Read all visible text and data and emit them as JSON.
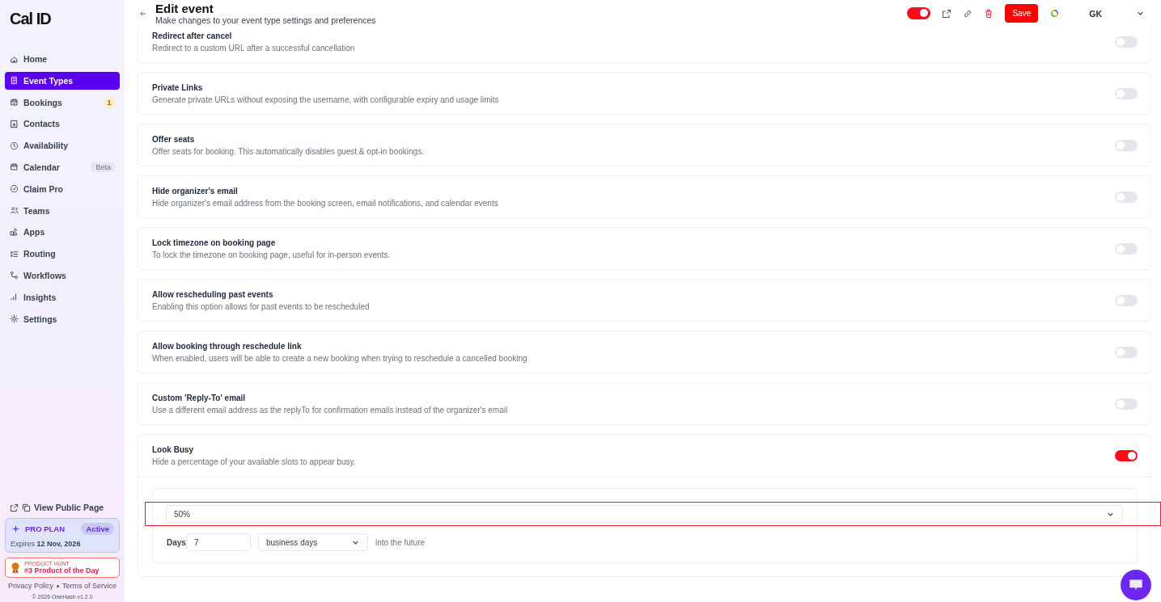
{
  "sidebar": {
    "logo": "Cal ID",
    "items": [
      {
        "label": "Home",
        "selected": false
      },
      {
        "label": "Event Types",
        "selected": true
      },
      {
        "label": "Bookings",
        "selected": false,
        "badge": {
          "text": "1",
          "kind": "count"
        }
      },
      {
        "label": "Contacts",
        "selected": false
      },
      {
        "label": "Availability",
        "selected": false
      },
      {
        "label": "Calendar",
        "selected": false,
        "badge": {
          "text": "Beta",
          "kind": "tag"
        }
      },
      {
        "label": "Claim Pro",
        "selected": false
      },
      {
        "label": "Teams",
        "selected": false
      },
      {
        "label": "Apps",
        "selected": false
      },
      {
        "label": "Routing",
        "selected": false
      },
      {
        "label": "Workflows",
        "selected": false
      },
      {
        "label": "Insights",
        "selected": false
      },
      {
        "label": "Settings",
        "selected": false
      }
    ],
    "public_page": "View Public Page",
    "plan": {
      "name": "PRO PLAN",
      "status": "Active",
      "expires_label": "Expires",
      "expires_date": "12 Nov, 2026"
    },
    "product_hunt": {
      "eyebrow": "PRODUCT HUNT",
      "text": "#3 Product of the Day"
    },
    "links": [
      "Privacy Policy",
      "Terms of Service"
    ],
    "copyright": "© 2026 OneHash v1.2.0"
  },
  "header": {
    "title": "Edit event",
    "subtitle": "Make changes to your event type settings and preferences",
    "enabled": true,
    "save": "Save",
    "user": "GK"
  },
  "settings": [
    {
      "title": "Redirect after cancel",
      "description": "Redirect to a custom URL after a successful cancellation",
      "on": false
    },
    {
      "title": "Private Links",
      "description": "Generate private URLs without exposing the username, with configurable expiry and usage limits",
      "on": false
    },
    {
      "title": "Offer seats",
      "description": "Offer seats for booking. This automatically disables guest & opt-in bookings.",
      "on": false
    },
    {
      "title": "Hide organizer's email",
      "description": "Hide organizer's email address from the booking screen, email notifications, and calendar events",
      "on": false
    },
    {
      "title": "Lock timezone on booking page",
      "description": "To lock the timezone on booking page, useful for in-person events.",
      "on": false
    },
    {
      "title": "Allow rescheduling past events",
      "description": "Enabling this option allows for past events to be rescheduled",
      "on": false
    },
    {
      "title": "Allow booking through reschedule link",
      "description": "When enabled, users will be able to create a new booking when trying to reschedule a cancelled booking",
      "on": false
    },
    {
      "title": "Custom 'Reply-To' email",
      "description": "Use a different email address as the replyTo for confirmation emails instead of the organizer's email",
      "on": false
    },
    {
      "title": "Look Busy",
      "description": "Hide a percentage of your available slots to appear busy.",
      "on": true,
      "details": {
        "percentage": "50%",
        "highlighted": true,
        "days_label": "Days",
        "days_value": "7",
        "unit": "business days",
        "suffix": "into the future"
      }
    }
  ]
}
